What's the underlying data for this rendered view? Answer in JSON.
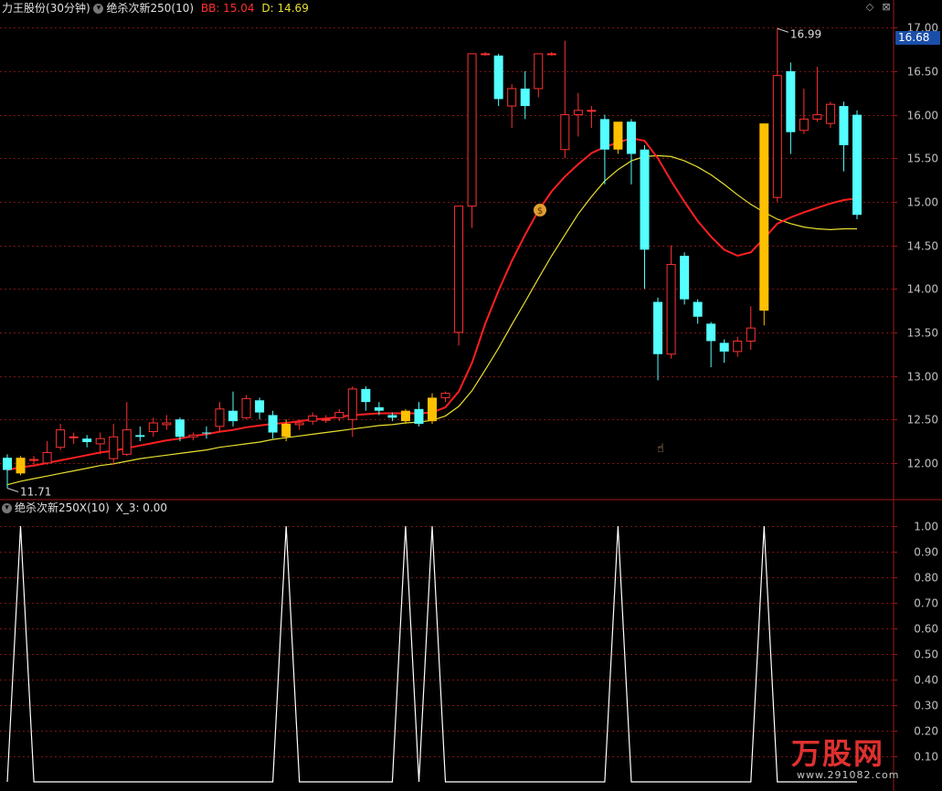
{
  "header": {
    "stock_name": "力王股份",
    "period": "(30分钟)",
    "indicator": "绝杀次新250(10)",
    "bb_label": "BB: 15.04",
    "d_label": "D: 14.69"
  },
  "subpanel": {
    "title": "绝杀次新250X(10)",
    "value_label": "X_3: 0.00"
  },
  "price_tag": "16.68",
  "high_label": "16.99",
  "low_label": "11.71",
  "window_controls": {
    "diamond": "◇",
    "close": "⊠"
  },
  "logo_text": "万股网",
  "logo_url": "www.291082.com",
  "colors": {
    "up": "#ff3232",
    "down": "#54ffff",
    "highlight": "#ffc000",
    "bb_line": "#ff2020",
    "d_line": "#e8e030",
    "grid": "#7a1414",
    "axis_text": "#c0c0c0",
    "signal": "#ffffff"
  },
  "chart_data": {
    "type": "candlestick",
    "ylim": [
      11.6,
      17.15
    ],
    "y_ticks": [
      12.0,
      12.5,
      13.0,
      13.5,
      14.0,
      14.5,
      15.0,
      15.5,
      16.0,
      16.5,
      17.0
    ],
    "y_tick_labels": [
      "12.00",
      "12.50",
      "13.00",
      "13.50",
      "14.00",
      "14.50",
      "15.00",
      "15.50",
      "16.00",
      "16.50",
      "17.00"
    ],
    "candles": [
      {
        "o": 12.06,
        "h": 12.1,
        "c": 11.92,
        "l": 11.71,
        "hl": false
      },
      {
        "o": 11.88,
        "h": 12.08,
        "c": 12.06,
        "l": 11.86,
        "hl": true
      },
      {
        "o": 12.03,
        "h": 12.08,
        "c": 12.04,
        "l": 11.98,
        "hl": false
      },
      {
        "o": 12.0,
        "h": 12.25,
        "c": 12.12,
        "l": 11.98,
        "hl": false
      },
      {
        "o": 12.18,
        "h": 12.45,
        "c": 12.38,
        "l": 12.15,
        "hl": false
      },
      {
        "o": 12.3,
        "h": 12.35,
        "c": 12.3,
        "l": 12.22,
        "hl": false
      },
      {
        "o": 12.28,
        "h": 12.32,
        "c": 12.24,
        "l": 12.18,
        "hl": false
      },
      {
        "o": 12.22,
        "h": 12.35,
        "c": 12.28,
        "l": 12.1,
        "hl": false
      },
      {
        "o": 12.05,
        "h": 12.45,
        "c": 12.3,
        "l": 11.98,
        "hl": false
      },
      {
        "o": 12.1,
        "h": 12.7,
        "c": 12.38,
        "l": 12.08,
        "hl": false
      },
      {
        "o": 12.32,
        "h": 12.42,
        "c": 12.3,
        "l": 12.25,
        "hl": false
      },
      {
        "o": 12.36,
        "h": 12.52,
        "c": 12.46,
        "l": 12.3,
        "hl": false
      },
      {
        "o": 12.44,
        "h": 12.55,
        "c": 12.46,
        "l": 12.38,
        "hl": false
      },
      {
        "o": 12.5,
        "h": 12.52,
        "c": 12.3,
        "l": 12.25,
        "hl": false
      },
      {
        "o": 12.3,
        "h": 12.35,
        "c": 12.32,
        "l": 12.26,
        "hl": false
      },
      {
        "o": 12.35,
        "h": 12.42,
        "c": 12.34,
        "l": 12.28,
        "hl": false
      },
      {
        "o": 12.42,
        "h": 12.7,
        "c": 12.62,
        "l": 12.35,
        "hl": false
      },
      {
        "o": 12.6,
        "h": 12.82,
        "c": 12.48,
        "l": 12.42,
        "hl": false
      },
      {
        "o": 12.52,
        "h": 12.78,
        "c": 12.74,
        "l": 12.5,
        "hl": false
      },
      {
        "o": 12.72,
        "h": 12.75,
        "c": 12.58,
        "l": 12.5,
        "hl": false
      },
      {
        "o": 12.55,
        "h": 12.6,
        "c": 12.35,
        "l": 12.28,
        "hl": false
      },
      {
        "o": 12.3,
        "h": 12.5,
        "c": 12.45,
        "l": 12.25,
        "hl": true
      },
      {
        "o": 12.44,
        "h": 12.5,
        "c": 12.46,
        "l": 12.38,
        "hl": false
      },
      {
        "o": 12.48,
        "h": 12.58,
        "c": 12.54,
        "l": 12.44,
        "hl": false
      },
      {
        "o": 12.5,
        "h": 12.55,
        "c": 12.5,
        "l": 12.46,
        "hl": false
      },
      {
        "o": 12.52,
        "h": 12.62,
        "c": 12.58,
        "l": 12.48,
        "hl": false
      },
      {
        "o": 12.5,
        "h": 12.88,
        "c": 12.85,
        "l": 12.3,
        "hl": false
      },
      {
        "o": 12.85,
        "h": 12.88,
        "c": 12.7,
        "l": 12.6,
        "hl": false
      },
      {
        "o": 12.64,
        "h": 12.7,
        "c": 12.6,
        "l": 12.55,
        "hl": false
      },
      {
        "o": 12.55,
        "h": 12.58,
        "c": 12.52,
        "l": 12.48,
        "hl": false
      },
      {
        "o": 12.48,
        "h": 12.62,
        "c": 12.6,
        "l": 12.45,
        "hl": true
      },
      {
        "o": 12.62,
        "h": 12.7,
        "c": 12.45,
        "l": 12.42,
        "hl": false
      },
      {
        "o": 12.48,
        "h": 12.8,
        "c": 12.75,
        "l": 12.45,
        "hl": true
      },
      {
        "o": 12.75,
        "h": 12.82,
        "c": 12.8,
        "l": 12.7,
        "hl": false
      },
      {
        "o": 13.5,
        "h": 13.88,
        "c": 14.95,
        "l": 13.35,
        "hl": false
      },
      {
        "o": 14.95,
        "h": 16.7,
        "c": 16.7,
        "l": 14.7,
        "hl": false
      },
      {
        "o": 16.7,
        "h": 16.72,
        "c": 16.7,
        "l": 16.68,
        "hl": false
      },
      {
        "o": 16.68,
        "h": 16.7,
        "c": 16.18,
        "l": 16.1,
        "hl": false
      },
      {
        "o": 16.1,
        "h": 16.35,
        "c": 16.3,
        "l": 15.85,
        "hl": false
      },
      {
        "o": 16.3,
        "h": 16.5,
        "c": 16.1,
        "l": 15.95,
        "hl": false
      },
      {
        "o": 16.3,
        "h": 16.7,
        "c": 16.7,
        "l": 16.2,
        "hl": false
      },
      {
        "o": 16.7,
        "h": 16.72,
        "c": 16.7,
        "l": 16.68,
        "hl": false
      },
      {
        "o": 15.6,
        "h": 16.85,
        "c": 16.0,
        "l": 15.5,
        "hl": false
      },
      {
        "o": 16.0,
        "h": 16.25,
        "c": 16.05,
        "l": 15.75,
        "hl": false
      },
      {
        "o": 16.05,
        "h": 16.1,
        "c": 16.05,
        "l": 15.85,
        "hl": false
      },
      {
        "o": 15.95,
        "h": 16.0,
        "c": 15.6,
        "l": 15.2,
        "hl": false
      },
      {
        "o": 15.6,
        "h": 15.9,
        "c": 15.92,
        "l": 15.55,
        "hl": true
      },
      {
        "o": 15.92,
        "h": 15.95,
        "c": 15.55,
        "l": 15.2,
        "hl": false
      },
      {
        "o": 15.6,
        "h": 15.65,
        "c": 14.45,
        "l": 14.0,
        "hl": false
      },
      {
        "o": 13.85,
        "h": 13.9,
        "c": 13.25,
        "l": 12.95,
        "hl": false
      },
      {
        "o": 13.25,
        "h": 14.5,
        "c": 14.28,
        "l": 13.2,
        "hl": false
      },
      {
        "o": 14.38,
        "h": 14.42,
        "c": 13.88,
        "l": 13.82,
        "hl": false
      },
      {
        "o": 13.85,
        "h": 13.88,
        "c": 13.68,
        "l": 13.6,
        "hl": false
      },
      {
        "o": 13.6,
        "h": 13.62,
        "c": 13.4,
        "l": 13.1,
        "hl": false
      },
      {
        "o": 13.38,
        "h": 13.42,
        "c": 13.28,
        "l": 13.15,
        "hl": false
      },
      {
        "o": 13.28,
        "h": 13.45,
        "c": 13.4,
        "l": 13.22,
        "hl": false
      },
      {
        "o": 13.4,
        "h": 13.8,
        "c": 13.55,
        "l": 13.3,
        "hl": false
      },
      {
        "o": 13.75,
        "h": 15.9,
        "c": 15.9,
        "l": 13.58,
        "hl": true
      },
      {
        "o": 15.05,
        "h": 16.99,
        "c": 16.45,
        "l": 15.0,
        "hl": false
      },
      {
        "o": 16.5,
        "h": 16.6,
        "c": 15.8,
        "l": 15.55,
        "hl": false
      },
      {
        "o": 15.82,
        "h": 16.3,
        "c": 15.95,
        "l": 15.78,
        "hl": false
      },
      {
        "o": 15.95,
        "h": 16.55,
        "c": 16.0,
        "l": 15.92,
        "hl": false
      },
      {
        "o": 15.9,
        "h": 16.15,
        "c": 16.12,
        "l": 15.85,
        "hl": false
      },
      {
        "o": 16.1,
        "h": 16.15,
        "c": 15.65,
        "l": 15.35,
        "hl": false
      },
      {
        "o": 16.0,
        "h": 16.05,
        "c": 14.85,
        "l": 14.8,
        "hl": false
      }
    ],
    "bb": [
      11.92,
      11.95,
      11.97,
      12.0,
      12.03,
      12.06,
      12.09,
      12.12,
      12.14,
      12.17,
      12.2,
      12.23,
      12.26,
      12.28,
      12.31,
      12.33,
      12.36,
      12.38,
      12.41,
      12.43,
      12.45,
      12.46,
      12.48,
      12.5,
      12.51,
      12.53,
      12.55,
      12.56,
      12.57,
      12.57,
      12.57,
      12.57,
      12.58,
      12.64,
      12.82,
      13.15,
      13.6,
      13.98,
      14.32,
      14.62,
      14.9,
      15.12,
      15.29,
      15.43,
      15.56,
      15.63,
      15.68,
      15.73,
      15.7,
      15.5,
      15.24,
      15.0,
      14.78,
      14.6,
      14.45,
      14.38,
      14.42,
      14.58,
      14.75,
      14.82,
      14.88,
      14.93,
      14.98,
      15.02,
      15.04
    ],
    "d": [
      11.75,
      11.79,
      11.82,
      11.85,
      11.88,
      11.91,
      11.94,
      11.97,
      11.99,
      12.02,
      12.05,
      12.07,
      12.09,
      12.11,
      12.13,
      12.15,
      12.18,
      12.2,
      12.22,
      12.24,
      12.27,
      12.29,
      12.31,
      12.33,
      12.35,
      12.37,
      12.39,
      12.41,
      12.43,
      12.44,
      12.46,
      12.47,
      12.49,
      12.54,
      12.65,
      12.83,
      13.07,
      13.32,
      13.59,
      13.85,
      14.12,
      14.38,
      14.62,
      14.86,
      15.06,
      15.24,
      15.37,
      15.47,
      15.52,
      15.53,
      15.52,
      15.47,
      15.4,
      15.31,
      15.2,
      15.08,
      14.97,
      14.88,
      14.8,
      14.75,
      14.71,
      14.69,
      14.68,
      14.69,
      14.69
    ],
    "signal": {
      "name": "X_3",
      "ylim": [
        0,
        1.05
      ],
      "y_ticks": [
        0.1,
        0.2,
        0.3,
        0.4,
        0.5,
        0.6,
        0.7,
        0.8,
        0.9,
        1.0
      ],
      "y_tick_labels": [
        "0.10",
        "0.20",
        "0.30",
        "0.40",
        "0.50",
        "0.60",
        "0.70",
        "0.80",
        "0.90",
        "1.00"
      ],
      "values": [
        0,
        1,
        0,
        0,
        0,
        0,
        0,
        0,
        0,
        0,
        0,
        0,
        0,
        0,
        0,
        0,
        0,
        0,
        0,
        0,
        0,
        1,
        0,
        0,
        0,
        0,
        0,
        0,
        0,
        0,
        1,
        0,
        1,
        0,
        0,
        0,
        0,
        0,
        0,
        0,
        0,
        0,
        0,
        0,
        0,
        0,
        1,
        0,
        0,
        0,
        0,
        0,
        0,
        0,
        0,
        0,
        0,
        1,
        0,
        0,
        0,
        0,
        0,
        0,
        0
      ]
    }
  }
}
